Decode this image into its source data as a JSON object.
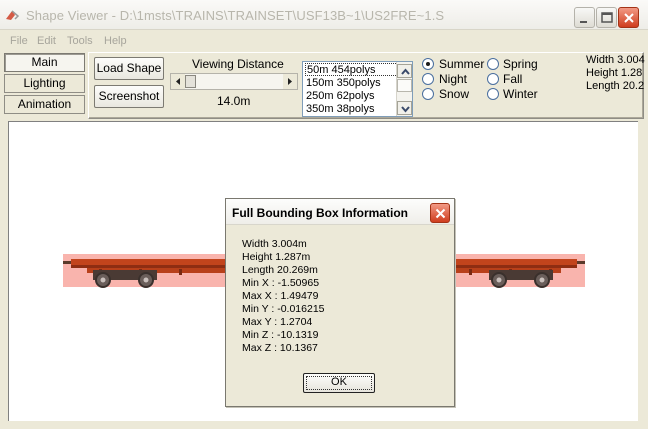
{
  "window": {
    "title": "Shape Viewer - D:\\1msts\\TRAINS\\TRAINSET\\USF13B~1\\US2FRE~1.S"
  },
  "menu": [
    "File",
    "Edit",
    "Tools",
    "Help"
  ],
  "side_tabs": [
    "Main",
    "Lighting",
    "Animation"
  ],
  "toolbar": {
    "load_shape": "Load Shape",
    "screenshot": "Screenshot",
    "viewing_distance_label": "Viewing Distance",
    "viewing_distance_value": "14.0m"
  },
  "lod_list": [
    "50m 454polys",
    "150m 350polys",
    "250m 62polys",
    "350m 38polys"
  ],
  "seasons": {
    "summer": "Summer",
    "spring": "Spring",
    "night": "Night",
    "fall": "Fall",
    "snow": "Snow",
    "winter": "Winter",
    "selected": "Summer"
  },
  "dimensions": {
    "width": "Width 3.004",
    "height": "Height 1.28",
    "length": "Length 20.2"
  },
  "dialog": {
    "title": "Full Bounding Box Information",
    "lines": [
      "Width 3.004m",
      "Height 1.287m",
      "Length 20.269m",
      "Min X : -1.50965",
      "Max X : 1.49479",
      "Min Y : -0.016215",
      "Max Y : 1.2704",
      "Min Z : -10.1319",
      "Max Z : 10.1367"
    ],
    "ok": "OK"
  },
  "colors": {
    "bounding_box": "#f9b4ad",
    "car_body": "#c2441c",
    "close_button": "#cf3d1e"
  }
}
